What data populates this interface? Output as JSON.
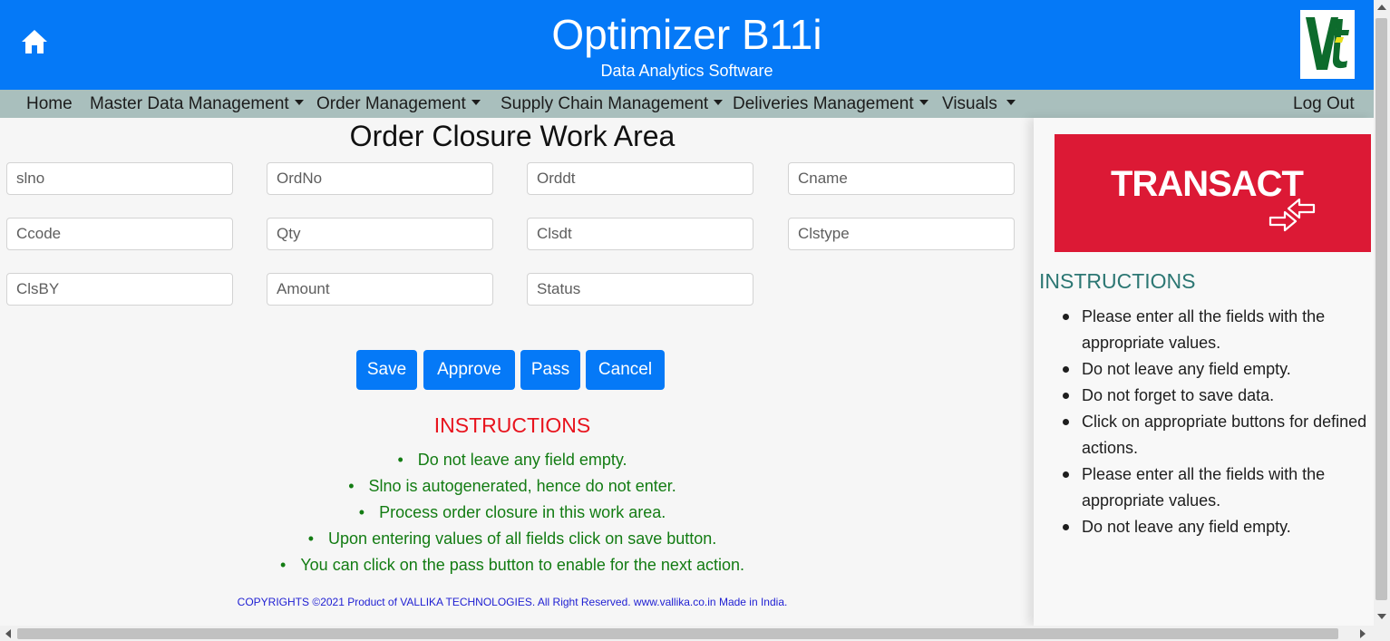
{
  "header": {
    "title": "Optimizer B11i",
    "subtitle": "Data Analytics Software",
    "home_icon": "home-icon",
    "logo_icon": "vt-logo",
    "brand_color": "#0579f7"
  },
  "nav": {
    "home": "Home",
    "master_data": "Master Data Management",
    "order_mgmt": "Order Management",
    "supply_chain": "Supply Chain Management",
    "deliveries": "Deliveries Management",
    "visuals": "Visuals",
    "logout": "Log Out",
    "bg_color": "#a9bfbd"
  },
  "work_area": {
    "title": "Order Closure Work Area",
    "fields": {
      "slno": "slno",
      "ordno": "OrdNo",
      "orddt": "Orddt",
      "cname": "Cname",
      "ccode": "Ccode",
      "qty": "Qty",
      "clsdt": "Clsdt",
      "clstype": "Clstype",
      "clsby": "ClsBY",
      "amount": "Amount",
      "status": "Status"
    },
    "buttons": {
      "save": "Save",
      "approve": "Approve",
      "pass": "Pass",
      "cancel": "Cancel"
    }
  },
  "instructions": {
    "title": "INSTRUCTIONS",
    "items": [
      "Do not leave any field empty.",
      "Slno is autogenerated, hence do not enter.",
      "Process order closure in this work area.",
      "Upon entering values of all fields click on save button.",
      "You can click on the pass button to enable for the next action."
    ],
    "title_color": "#e8141e",
    "item_color": "#137c13"
  },
  "footer": {
    "text": "COPYRIGHTS ©2021 Product of VALLIKA TECHNOLOGIES. All Right Reserved. www.vallika.co.in Made in India."
  },
  "side_panel": {
    "banner_text": "TRANSACT",
    "banner_icon": "transfer-arrows-icon",
    "banner_color": "#dc1935",
    "instructions_title": "INSTRUCTIONS",
    "instructions_title_color": "#2c7773",
    "items": [
      "Please enter all the fields with the appropriate values.",
      "Do not leave any field empty.",
      "Do not forget to save data.",
      "Click on appropriate buttons for defined actions.",
      "Please enter all the fields with the appropriate values.",
      "Do not leave any field empty."
    ]
  }
}
